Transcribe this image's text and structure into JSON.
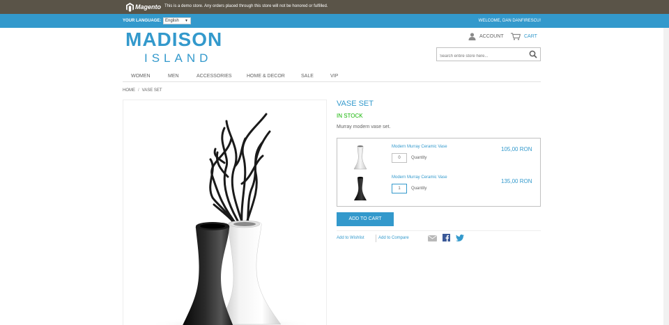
{
  "demo_notice": {
    "logo_text": "Magento",
    "message": "This is a demo store. Any orders placed through this store will not be honored or fulfilled."
  },
  "top_bar": {
    "language_label": "YOUR LANGUAGE:",
    "language_value": "English",
    "welcome": "WELCOME, DAN DANFIRESCU!"
  },
  "header": {
    "logo_line1": "MADISON",
    "logo_line2": "ISLAND",
    "account_label": "ACCOUNT",
    "cart_label": "CART",
    "search_placeholder": "Search entire store here...",
    "icons": {
      "account": "user-icon",
      "cart": "cart-icon",
      "search": "search-icon"
    }
  },
  "nav": {
    "items": [
      {
        "label": "WOMEN"
      },
      {
        "label": "MEN"
      },
      {
        "label": "ACCESSORIES"
      },
      {
        "label": "HOME & DECOR"
      },
      {
        "label": "SALE"
      },
      {
        "label": "VIP"
      }
    ]
  },
  "breadcrumb": {
    "home": "HOME",
    "separator": "/",
    "current": "VASE SET"
  },
  "product": {
    "name": "VASE SET",
    "stock": "IN STOCK",
    "description": "Murray modern vase set.",
    "grouped_items": [
      {
        "name": "Modern Murray Ceramic Vase",
        "qty": "0",
        "qty_label": "Quantity",
        "price": "105,00 RON",
        "color": "white"
      },
      {
        "name": "Modern Murray Ceramic Vase",
        "qty": "1",
        "qty_label": "Quantity",
        "price": "135,00 RON",
        "color": "black"
      }
    ],
    "add_to_cart": "ADD TO CART",
    "add_to_wishlist": "Add to Wishlist",
    "add_to_compare": "Add to Compare",
    "share_icons": [
      "email-icon",
      "facebook-icon",
      "twitter-icon"
    ]
  },
  "colors": {
    "brand_blue": "#3399cc",
    "demo_bar": "#5a5448",
    "in_stock_green": "#11b400"
  }
}
